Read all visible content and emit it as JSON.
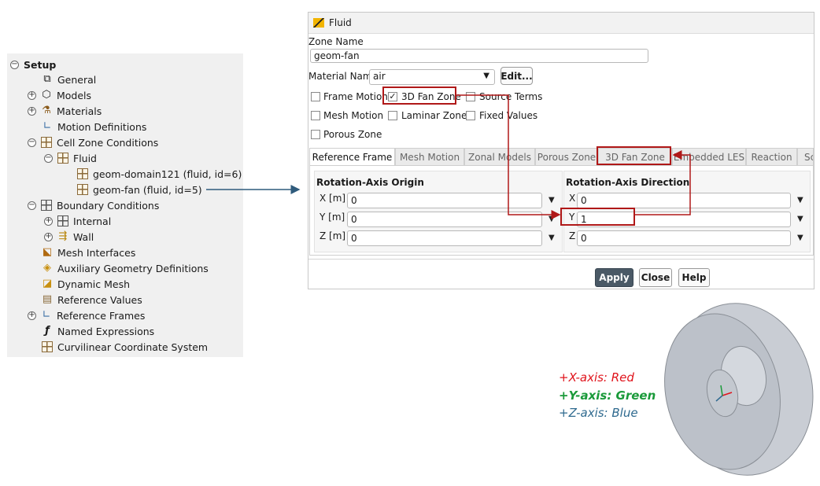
{
  "tree": {
    "items": [
      {
        "label": "Setup"
      },
      {
        "label": "General"
      },
      {
        "label": "Models"
      },
      {
        "label": "Materials"
      },
      {
        "label": "Motion Definitions"
      },
      {
        "label": "Cell Zone Conditions"
      },
      {
        "label": "Fluid"
      },
      {
        "label": "geom-domain121 (fluid, id=6)"
      },
      {
        "label": "geom-fan (fluid, id=5)"
      },
      {
        "label": "Boundary Conditions"
      },
      {
        "label": "Internal"
      },
      {
        "label": "Wall"
      },
      {
        "label": "Mesh Interfaces"
      },
      {
        "label": "Auxiliary Geometry Definitions"
      },
      {
        "label": "Dynamic Mesh"
      },
      {
        "label": "Reference Values"
      },
      {
        "label": "Reference Frames"
      },
      {
        "label": "Named Expressions"
      },
      {
        "label": "Curvilinear Coordinate System"
      }
    ]
  },
  "dialog": {
    "title": "Fluid",
    "zone_name_label": "Zone Name",
    "zone_name_value": "geom-fan",
    "material_label": "Material Name",
    "material_value": "air",
    "edit_label": "Edit...",
    "checkboxes": [
      {
        "label": "Frame Motion",
        "checked": false
      },
      {
        "label": "3D Fan Zone",
        "checked": true
      },
      {
        "label": "Source Terms",
        "checked": false
      },
      {
        "label": "Mesh Motion",
        "checked": false
      },
      {
        "label": "Laminar Zone",
        "checked": false
      },
      {
        "label": "Fixed Values",
        "checked": false
      },
      {
        "label": "Porous Zone",
        "checked": false
      }
    ],
    "tabs": [
      "Reference Frame",
      "Mesh Motion",
      "Zonal Models",
      "Porous Zone",
      "3D Fan Zone",
      "Embedded LES",
      "Reaction",
      "Sc"
    ],
    "origin": {
      "heading": "Rotation-Axis Origin",
      "fields": [
        {
          "label": "X [m]",
          "value": "0"
        },
        {
          "label": "Y [m]",
          "value": "0"
        },
        {
          "label": "Z [m]",
          "value": "0"
        }
      ]
    },
    "direction": {
      "heading": "Rotation-Axis Direction",
      "fields": [
        {
          "label": "X",
          "value": "0"
        },
        {
          "label": "Y",
          "value": "1"
        },
        {
          "label": "Z",
          "value": "0"
        }
      ]
    },
    "buttons": {
      "apply": "Apply",
      "close": "Close",
      "help": "Help"
    }
  },
  "axes_legend": {
    "x": "+X-axis: Red",
    "y": "+Y-axis: Green",
    "z": "+Z-axis: Blue",
    "colors": {
      "x": "#e0141c",
      "y": "#1a9a3a",
      "z": "#2f6a8f"
    }
  },
  "colors": {
    "highlight": "#b01818",
    "arrow": "#2f5b7c",
    "apply": "#4a5966"
  }
}
